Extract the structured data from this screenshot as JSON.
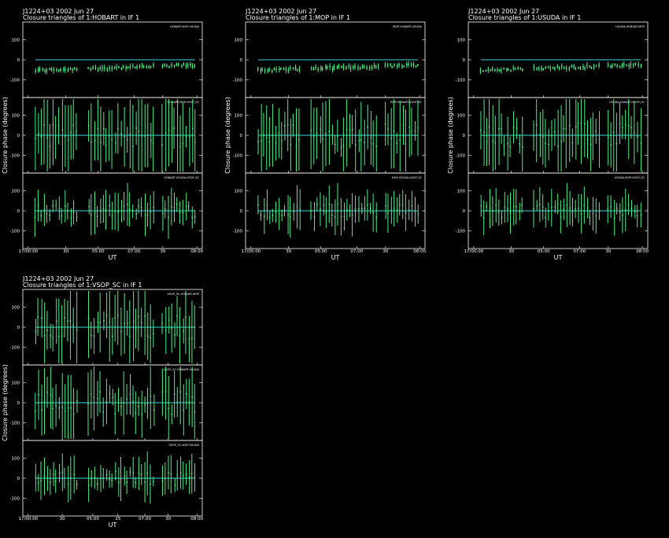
{
  "colors": {
    "background": "#000000",
    "data": "#4df08a",
    "model": "#3fd6d6",
    "frame": "#ffffff"
  },
  "chart_data": [
    {
      "type": "scatter",
      "title": "J1224+03  2002 Jun 27",
      "subtitle": "Closure triangles of 1:HOBART in IF 1",
      "ylabel": "Closure phase  (degrees)",
      "xlabel": "UT",
      "xticks": [
        "17/00:00",
        "30",
        "05:00",
        "07:00",
        "30",
        "08:00"
      ],
      "ylim": [
        -180,
        180
      ],
      "yticks": [
        "100",
        "0",
        "-100"
      ],
      "subplots": [
        {
          "label": "HOBART-MOP-USUDA",
          "pattern": "stable",
          "offset": -40,
          "err": 12
        },
        {
          "label": "HOBART-MOP-VSOP_SC",
          "pattern": "wild",
          "offset": 0,
          "err": 180
        },
        {
          "label": "HOBART-USUDA-VSOP_SC",
          "pattern": "mid",
          "offset": 0,
          "err": 110
        }
      ]
    },
    {
      "type": "scatter",
      "title": "J1224+03  2002 Jun 27",
      "subtitle": "Closure triangles of 1:MOP in IF 1",
      "ylabel": "Closure phase  (degrees)",
      "xlabel": "UT",
      "xticks": [
        "17/00:00",
        "30",
        "05:00",
        "07:00",
        "30",
        "08:00"
      ],
      "ylim": [
        -180,
        180
      ],
      "yticks": [
        "100",
        "0",
        "-100"
      ],
      "subplots": [
        {
          "label": "MOP-HOBART-USUDA",
          "pattern": "stable",
          "offset": -40,
          "err": 12
        },
        {
          "label": "MOP-HOBART-VSOP_SC",
          "pattern": "wild",
          "offset": 0,
          "err": 180
        },
        {
          "label": "MOP-USUDA-VSOP_SC",
          "pattern": "mid",
          "offset": 0,
          "err": 110
        }
      ]
    },
    {
      "type": "scatter",
      "title": "J1224+03  2002 Jun 27",
      "subtitle": "Closure triangles of 1:USUDA in IF 1",
      "ylabel": "Closure phase  (degrees)",
      "xlabel": "UT",
      "xticks": [
        "17/00:00",
        "30",
        "05:00",
        "07:00",
        "30",
        "08:00"
      ],
      "ylim": [
        -180,
        180
      ],
      "yticks": [
        "100",
        "0",
        "-100"
      ],
      "subplots": [
        {
          "label": "USUDA-HOBART-MOP",
          "pattern": "stable",
          "offset": -40,
          "err": 12
        },
        {
          "label": "USUDA-HOBART-VSOP_SC",
          "pattern": "wild",
          "offset": 0,
          "err": 180
        },
        {
          "label": "USUDA-MOP-VSOP_SC",
          "pattern": "mid",
          "offset": 0,
          "err": 110
        }
      ]
    },
    {
      "type": "scatter",
      "title": "J1224+03  2002 Jun 27",
      "subtitle": "Closure triangles of 1:VSOP_SC in IF 1",
      "ylabel": "Closure phase  (degrees)",
      "xlabel": "UT",
      "xticks": [
        "17/00:00",
        "30",
        "05:00",
        "25",
        "07:00",
        "30",
        "08:00"
      ],
      "ylim": [
        -180,
        180
      ],
      "yticks": [
        "100",
        "0",
        "-100"
      ],
      "subplots": [
        {
          "label": "VSOP_SC-HOBART-MOP",
          "pattern": "wild",
          "offset": 0,
          "err": 180
        },
        {
          "label": "VSOP_SC-HOBART-USUDA",
          "pattern": "wild",
          "offset": 0,
          "err": 150
        },
        {
          "label": "VSOP_SC-MOP-USUDA",
          "pattern": "mid",
          "offset": 0,
          "err": 110
        }
      ]
    }
  ]
}
